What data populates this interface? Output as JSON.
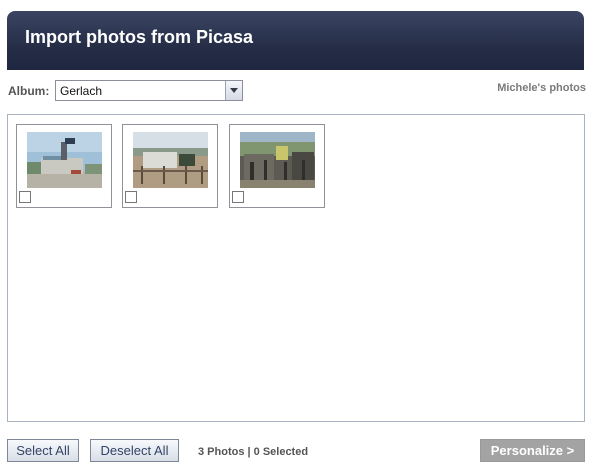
{
  "header": {
    "title": "Import photos from Picasa"
  },
  "album": {
    "label": "Album:",
    "selected": "Gerlach",
    "owner": "Michele's photos"
  },
  "photos": [
    {
      "name": "photo-1",
      "checked": false
    },
    {
      "name": "photo-2",
      "checked": false
    },
    {
      "name": "photo-3",
      "checked": false
    }
  ],
  "footer": {
    "select_all": "Select All",
    "deselect_all": "Deselect All",
    "status": "3 Photos | 0 Selected",
    "personalize": "Personalize >"
  },
  "colors": {
    "header_bg": "#262e47",
    "panel_border": "#a9b4c4",
    "personalize_disabled": "#a3a3a3"
  },
  "icons": {
    "dropdown": "chevron-down-icon"
  }
}
